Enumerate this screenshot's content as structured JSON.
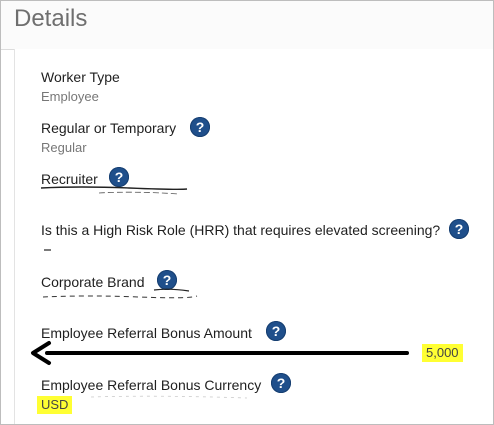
{
  "section_title": "Details",
  "fields": {
    "worker_type": {
      "label": "Worker Type",
      "value": "Employee"
    },
    "regular_or_temporary": {
      "label": "Regular or Temporary",
      "value": "Regular"
    },
    "recruiter": {
      "label": "Recruiter"
    },
    "high_risk_role": {
      "label": "Is this a High Risk Role (HRR) that requires elevated screening?"
    },
    "corporate_brand": {
      "label": "Corporate Brand"
    },
    "referral_bonus_amount": {
      "label": "Employee Referral Bonus Amount",
      "value": "5,000"
    },
    "referral_bonus_currency": {
      "label": "Employee Referral Bonus Currency",
      "value": "USD"
    }
  },
  "help_icon_glyph": "?",
  "colors": {
    "help_icon": "#1f4f8b",
    "highlight": "#ffff33",
    "arrow": "#000000"
  },
  "icons": {
    "help": "question-circle-icon",
    "annotation": "arrow-left-icon"
  }
}
